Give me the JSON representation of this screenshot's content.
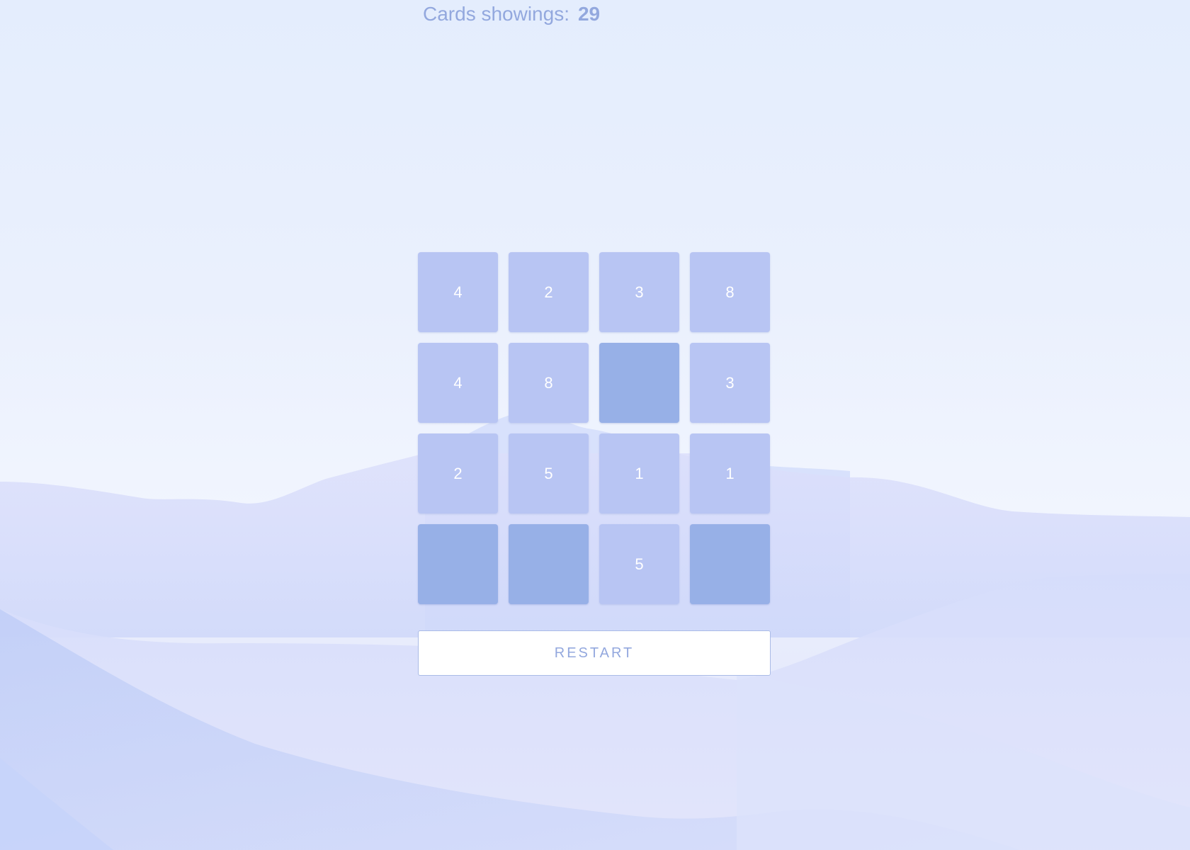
{
  "counter": {
    "label": "Cards showings:",
    "value": "29"
  },
  "board": {
    "rows": 4,
    "cols": 4,
    "cards": [
      {
        "value": "4",
        "state": "face-up"
      },
      {
        "value": "2",
        "state": "face-up"
      },
      {
        "value": "3",
        "state": "face-up"
      },
      {
        "value": "8",
        "state": "face-up"
      },
      {
        "value": "4",
        "state": "face-up"
      },
      {
        "value": "8",
        "state": "face-up"
      },
      {
        "value": "",
        "state": "face-down"
      },
      {
        "value": "3",
        "state": "face-up"
      },
      {
        "value": "2",
        "state": "face-up"
      },
      {
        "value": "5",
        "state": "face-up"
      },
      {
        "value": "1",
        "state": "face-up"
      },
      {
        "value": "1",
        "state": "face-up"
      },
      {
        "value": "",
        "state": "face-down"
      },
      {
        "value": "",
        "state": "face-down"
      },
      {
        "value": "5",
        "state": "face-up"
      },
      {
        "value": "",
        "state": "face-down"
      }
    ]
  },
  "restart_label": "RESTART",
  "colors": {
    "face_up": "#b8c5f3",
    "face_down": "#97b0e7",
    "text_accent": "#93a8de"
  }
}
